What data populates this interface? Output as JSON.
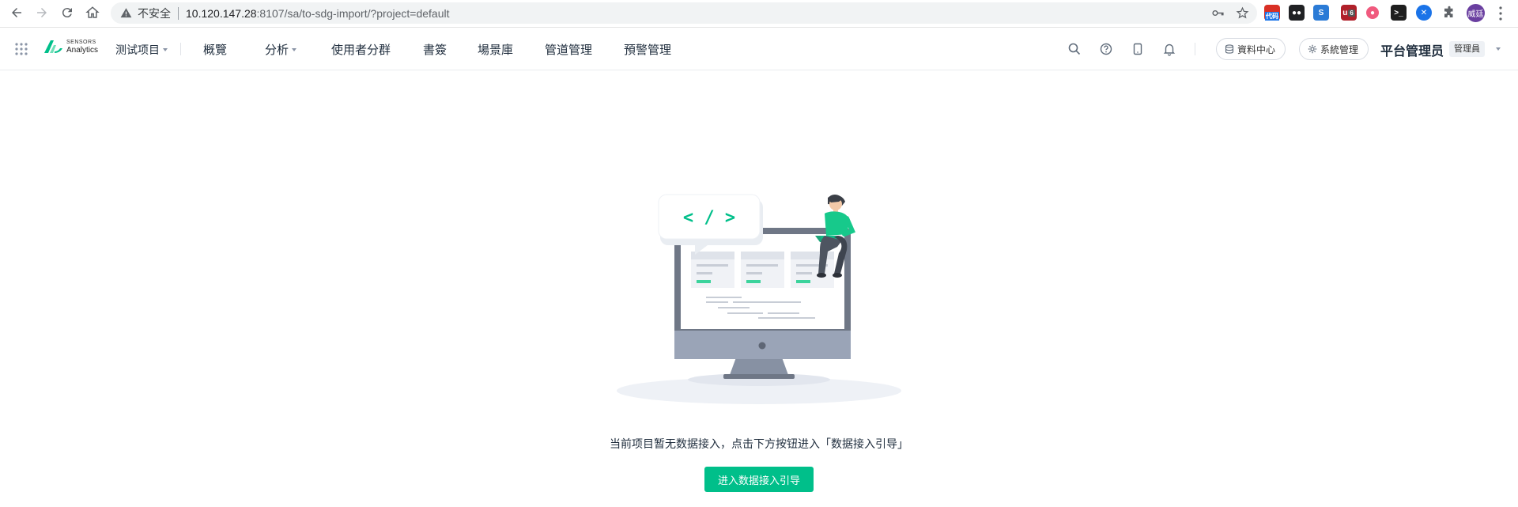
{
  "browser": {
    "security_label": "不安全",
    "url_host": "10.120.147.28",
    "url_rest": ":8107/sa/to-sdg-import/?project=default",
    "profile_initials": "威廷",
    "ext_badge_1": "代码",
    "ext_badge_count": "6"
  },
  "header": {
    "logo_line1": "SENSORS",
    "logo_line2": "Analytics",
    "project": "测试项目",
    "menu": [
      {
        "label": "概覽"
      },
      {
        "label": "分析"
      },
      {
        "label": "使用者分群"
      },
      {
        "label": "書簽"
      },
      {
        "label": "場景庫"
      },
      {
        "label": "管道管理"
      },
      {
        "label": "預警管理"
      }
    ],
    "data_center": "資料中心",
    "system_admin": "系統管理",
    "user_name": "平台管理员",
    "user_role": "管理員"
  },
  "main": {
    "empty_message": "当前项目暂无数据接入，点击下方按钮进入「数据接入引导」",
    "cta_label": "进入数据接入引导",
    "code_bubble": "< / >"
  },
  "colors": {
    "accent": "#00bf8a",
    "monitor_frame": "#6f7786",
    "text": "#1f2d3d"
  }
}
